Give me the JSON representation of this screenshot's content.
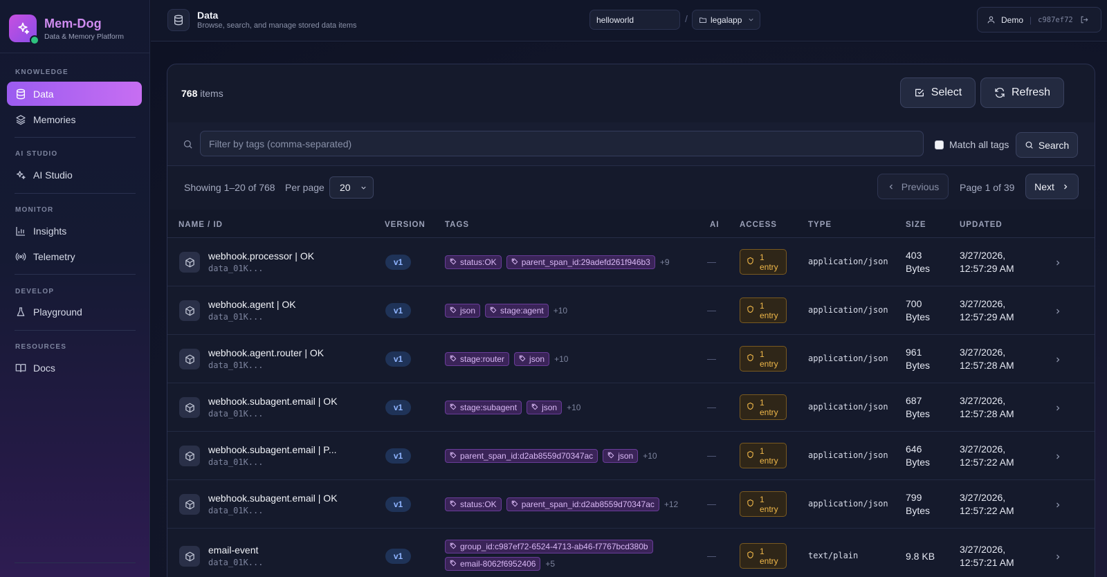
{
  "brand": {
    "name": "Mem-Dog",
    "subtitle": "Data & Memory Platform"
  },
  "sidebar": {
    "sections": [
      {
        "label": "KNOWLEDGE",
        "items": [
          {
            "label": "Data",
            "icon": "database-icon",
            "active": true
          },
          {
            "label": "Memories",
            "icon": "layers-icon",
            "active": false
          }
        ]
      },
      {
        "label": "AI STUDIO",
        "items": [
          {
            "label": "AI Studio",
            "icon": "sparkles-icon",
            "active": false
          }
        ]
      },
      {
        "label": "MONITOR",
        "items": [
          {
            "label": "Insights",
            "icon": "bar-chart-icon",
            "active": false
          },
          {
            "label": "Telemetry",
            "icon": "broadcast-icon",
            "active": false
          }
        ]
      },
      {
        "label": "DEVELOP",
        "items": [
          {
            "label": "Playground",
            "icon": "flask-icon",
            "active": false
          }
        ]
      },
      {
        "label": "RESOURCES",
        "items": [
          {
            "label": "Docs",
            "icon": "book-icon",
            "active": false
          }
        ]
      }
    ]
  },
  "header": {
    "title": "Data",
    "subtitle": "Browse, search, and manage stored data items",
    "project": "helloworld",
    "separator": "/",
    "app": "legalapp",
    "user": "Demo",
    "user_id": "c987ef72"
  },
  "toolbar": {
    "count": "768",
    "count_suffix": "items",
    "select_label": "Select",
    "refresh_label": "Refresh"
  },
  "filter": {
    "placeholder": "Filter by tags (comma-separated)",
    "match_all_label": "Match all tags",
    "match_all_checked": false,
    "search_label": "Search"
  },
  "pagination": {
    "showing": "Showing 1–20 of 768",
    "per_page_label": "Per page",
    "per_page": "20",
    "previous_label": "Previous",
    "page_info": "Page 1 of 39",
    "next_label": "Next"
  },
  "table": {
    "columns": [
      "NAME / ID",
      "VERSION",
      "TAGS",
      "AI",
      "ACCESS",
      "TYPE",
      "SIZE",
      "UPDATED"
    ],
    "rows": [
      {
        "name": "webhook.processor | OK",
        "id": "data_01K...",
        "version": "v1",
        "tags": [
          "status:OK",
          "parent_span_id:29adefd261f946b3"
        ],
        "more": "+9",
        "ai": "—",
        "access_count": "1",
        "access_unit": "entry",
        "type": "application/json",
        "size_value": "403",
        "size_unit": "Bytes",
        "updated_date": "3/27/2026,",
        "updated_time": "12:57:29 AM"
      },
      {
        "name": "webhook.agent | OK",
        "id": "data_01K...",
        "version": "v1",
        "tags": [
          "json",
          "stage:agent"
        ],
        "more": "+10",
        "ai": "—",
        "access_count": "1",
        "access_unit": "entry",
        "type": "application/json",
        "size_value": "700",
        "size_unit": "Bytes",
        "updated_date": "3/27/2026,",
        "updated_time": "12:57:29 AM"
      },
      {
        "name": "webhook.agent.router | OK",
        "id": "data_01K...",
        "version": "v1",
        "tags": [
          "stage:router",
          "json"
        ],
        "more": "+10",
        "ai": "—",
        "access_count": "1",
        "access_unit": "entry",
        "type": "application/json",
        "size_value": "961",
        "size_unit": "Bytes",
        "updated_date": "3/27/2026,",
        "updated_time": "12:57:28 AM"
      },
      {
        "name": "webhook.subagent.email | OK",
        "id": "data_01K...",
        "version": "v1",
        "tags": [
          "stage:subagent",
          "json"
        ],
        "more": "+10",
        "ai": "—",
        "access_count": "1",
        "access_unit": "entry",
        "type": "application/json",
        "size_value": "687",
        "size_unit": "Bytes",
        "updated_date": "3/27/2026,",
        "updated_time": "12:57:28 AM"
      },
      {
        "name": "webhook.subagent.email | P...",
        "id": "data_01K...",
        "version": "v1",
        "tags": [
          "parent_span_id:d2ab8559d70347ac",
          "json"
        ],
        "more": "+10",
        "ai": "—",
        "access_count": "1",
        "access_unit": "entry",
        "type": "application/json",
        "size_value": "646",
        "size_unit": "Bytes",
        "updated_date": "3/27/2026,",
        "updated_time": "12:57:22 AM"
      },
      {
        "name": "webhook.subagent.email | OK",
        "id": "data_01K...",
        "version": "v1",
        "tags": [
          "status:OK",
          "parent_span_id:d2ab8559d70347ac"
        ],
        "more": "+12",
        "ai": "—",
        "access_count": "1",
        "access_unit": "entry",
        "type": "application/json",
        "size_value": "799",
        "size_unit": "Bytes",
        "updated_date": "3/27/2026,",
        "updated_time": "12:57:22 AM"
      },
      {
        "name": "email-event",
        "id": "data_01K...",
        "version": "v1",
        "tags": [
          "group_id:c987ef72-6524-4713-ab46-f7767bcd380b",
          "email-8062f6952406"
        ],
        "more": "+5",
        "ai": "—",
        "access_count": "1",
        "access_unit": "entry",
        "type": "text/plain",
        "size_value": "9.8 KB",
        "size_unit": "",
        "updated_date": "3/27/2026,",
        "updated_time": "12:57:21 AM"
      }
    ]
  },
  "colors": {
    "accent": "#a866f0",
    "tag_bg": "#3a2458",
    "access": "#f0b84a",
    "version": "#8fb4ff"
  }
}
